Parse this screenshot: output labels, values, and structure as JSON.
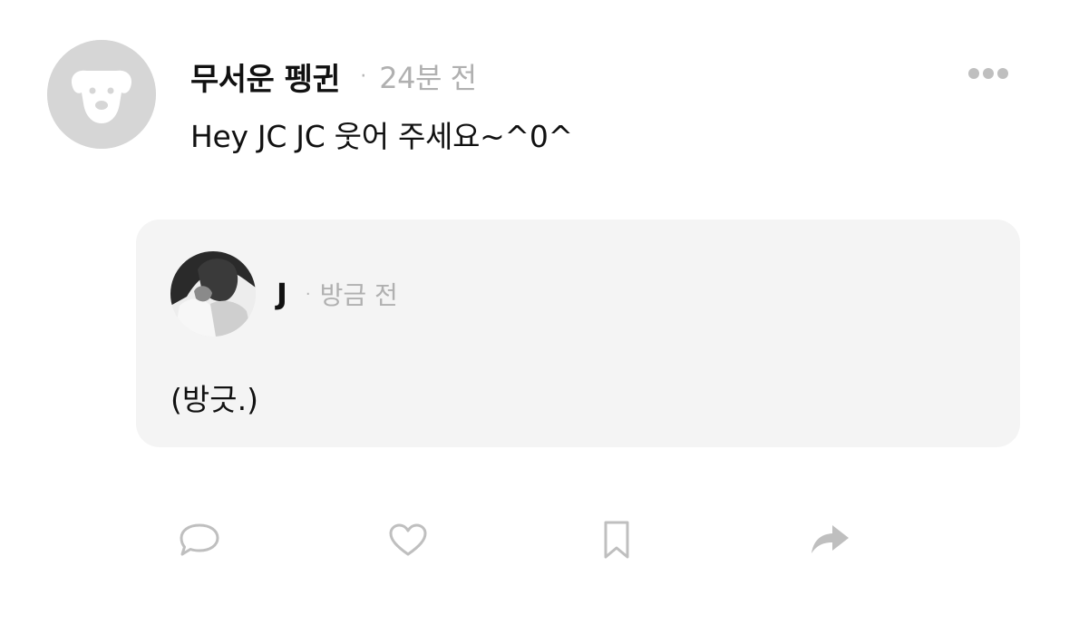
{
  "post": {
    "author": "무서운 펭귄",
    "separator": "·",
    "time": "24분 전",
    "text": "Hey JC JC 웃어 주세요~^0^",
    "avatar_icon": "dog-face-icon",
    "more_icon": "more-dots-icon"
  },
  "reply": {
    "author": "J",
    "separator": "·",
    "time": "방금 전",
    "text": "(방긋.)",
    "avatar_icon": "profile-photo"
  },
  "actions": [
    {
      "name": "comment",
      "icon": "comment-icon"
    },
    {
      "name": "like",
      "icon": "heart-icon"
    },
    {
      "name": "bookmark",
      "icon": "bookmark-icon"
    },
    {
      "name": "share",
      "icon": "share-arrow-icon"
    }
  ],
  "colors": {
    "background": "#ffffff",
    "card_background": "#f4f4f4",
    "avatar_placeholder": "#d6d6d6",
    "muted_text": "#b0b0b0",
    "icon_gray": "#bfbfbf",
    "primary_text": "#111111"
  }
}
